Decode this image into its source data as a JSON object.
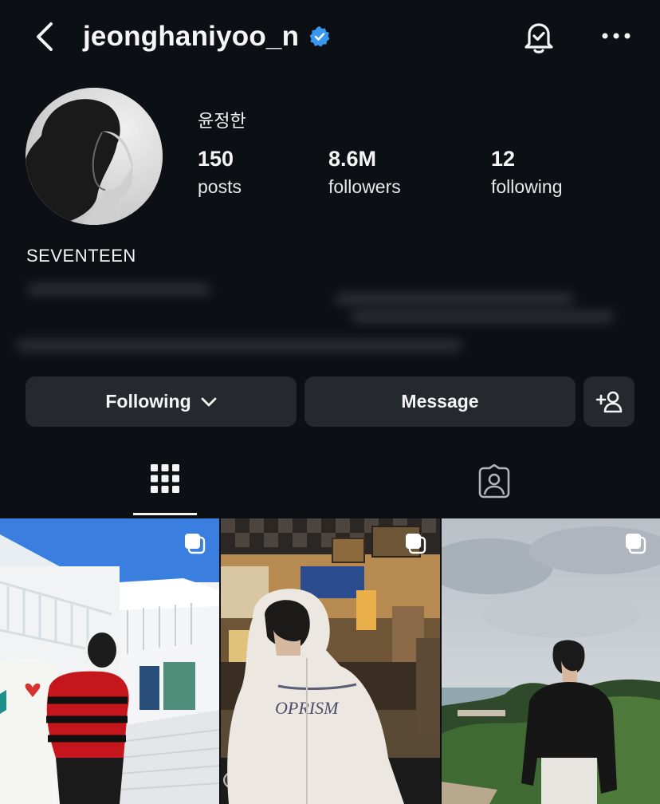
{
  "header": {
    "username": "jeonghaniyoo_n",
    "verified": true,
    "icons": [
      "back-icon",
      "verified-badge-icon",
      "notification-bell-icon",
      "more-options-icon"
    ]
  },
  "profile": {
    "display_name": "윤정한",
    "stats": [
      {
        "value": "150",
        "label": "posts"
      },
      {
        "value": "8.6M",
        "label": "followers"
      },
      {
        "value": "12",
        "label": "following"
      }
    ],
    "bio_title": "SEVENTEEN"
  },
  "actions": {
    "following_label": "Following",
    "message_label": "Message"
  },
  "tabs": [
    {
      "name": "posts-grid",
      "icon": "grid-icon",
      "active": true
    },
    {
      "name": "tagged",
      "icon": "tagged-person-icon",
      "active": false
    }
  ],
  "posts": [
    {
      "multiple": true
    },
    {
      "multiple": true
    },
    {
      "multiple": true
    }
  ],
  "colors": {
    "background": "#0c1014",
    "button": "#25292e",
    "verified": "#3897f0",
    "text": "#f5f5f5"
  }
}
